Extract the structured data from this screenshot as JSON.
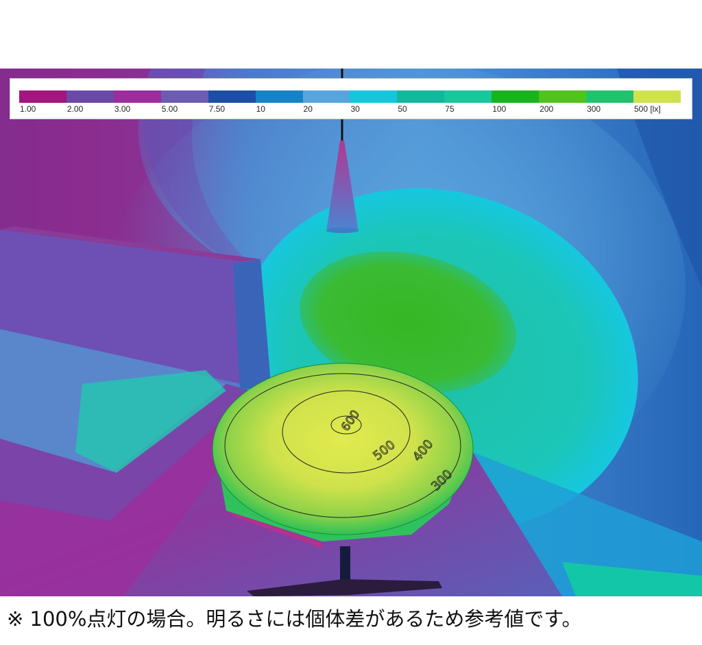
{
  "legend": {
    "colors": [
      "#a2167f",
      "#6b49a8",
      "#9c2d9d",
      "#6c5cb3",
      "#1d4ea6",
      "#1783c7",
      "#58a4de",
      "#14c6dc",
      "#12b79c",
      "#19c79a",
      "#19b31d",
      "#52c21e",
      "#20c36c",
      "#cfe24b"
    ],
    "labels": [
      "1.00",
      "2.00",
      "3.00",
      "5.00",
      "7.50",
      "10",
      "20",
      "30",
      "50",
      "75",
      "100",
      "200",
      "300",
      "500 [lx]"
    ]
  },
  "contours": [
    {
      "label": "600"
    },
    {
      "label": "500"
    },
    {
      "label": "400"
    },
    {
      "label": "300"
    }
  ],
  "caption": "※ 100%点灯の場合。明るさには個体差があるため参考値です。"
}
